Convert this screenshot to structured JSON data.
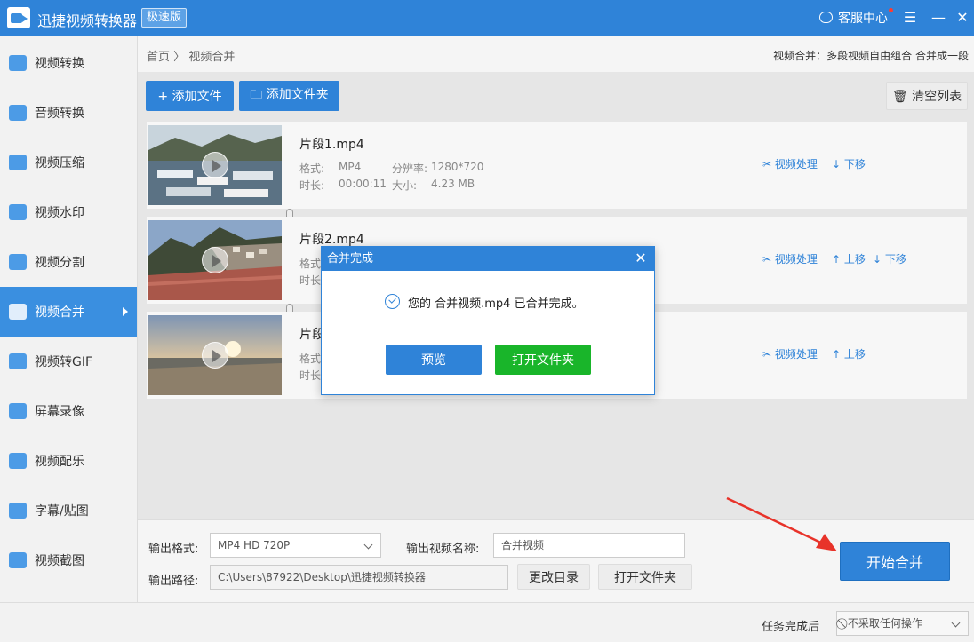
{
  "app": {
    "title": "迅捷视频转换器",
    "badge": "极速版",
    "service": "客服中心",
    "menu_icon": "☰",
    "min_icon": "—",
    "close_icon": "✕"
  },
  "sidebar": {
    "items": [
      {
        "label": "视频转换",
        "icon": "video-convert-icon"
      },
      {
        "label": "音频转换",
        "icon": "audio-convert-icon"
      },
      {
        "label": "视频压缩",
        "icon": "video-compress-icon"
      },
      {
        "label": "视频水印",
        "icon": "video-watermark-icon"
      },
      {
        "label": "视频分割",
        "icon": "video-split-icon"
      },
      {
        "label": "视频合并",
        "icon": "video-merge-icon",
        "active": true
      },
      {
        "label": "视频转GIF",
        "icon": "video-gif-icon"
      },
      {
        "label": "屏幕录像",
        "icon": "screen-record-icon"
      },
      {
        "label": "视频配乐",
        "icon": "video-music-icon"
      },
      {
        "label": "字幕/贴图",
        "icon": "subtitle-icon"
      },
      {
        "label": "视频截图",
        "icon": "screenshot-icon"
      }
    ]
  },
  "breadcrumb": {
    "home": "首页",
    "sep": "〉",
    "current": "视频合并"
  },
  "description": "视频合并：多段视频自由组合 合并成一段",
  "toolbar": {
    "add_file": "+ 添加文件",
    "add_folder": "🗀 添加文件夹",
    "clear": "🗑 清空列表"
  },
  "files": [
    {
      "name": "片段1.mp4",
      "format_label": "格式:",
      "format": "MP4",
      "res_label": "分辨率:",
      "resolution": "1280*720",
      "dur_label": "时长:",
      "duration": "00:00:11",
      "size_label": "大小:",
      "size": "4.23 MB",
      "actions": [
        "✂ 视频处理",
        "↓ 下移"
      ]
    },
    {
      "name": "片段2.mp4",
      "format_label": "格式",
      "dur_label": "时长",
      "actions": [
        "✂ 视频处理",
        "↑ 上移",
        "↓ 下移"
      ]
    },
    {
      "name": "片段",
      "format_label": "格式",
      "dur_label": "时长",
      "actions": [
        "✂ 视频处理",
        "↑ 上移"
      ]
    }
  ],
  "output": {
    "format_label": "输出格式:",
    "format_value": "MP4   HD 720P",
    "name_label": "输出视频名称:",
    "name_value": "合并视频",
    "path_label": "输出路径:",
    "path_value": "C:\\Users\\87922\\Desktop\\迅捷视频转换器",
    "change_dir": "更改目录",
    "open_folder": "打开文件夹",
    "start": "开始合并"
  },
  "footer": {
    "after_label": "任务完成后",
    "after_value": "⃠ 不采取任何操作"
  },
  "dialog": {
    "title": "合并完成",
    "message": "您的 合并视频.mp4 已合并完成。",
    "preview": "预览",
    "open_folder": "打开文件夹"
  },
  "colors": {
    "accent": "#2f83d8",
    "green": "#19b52a",
    "arrow": "#e8332a"
  }
}
